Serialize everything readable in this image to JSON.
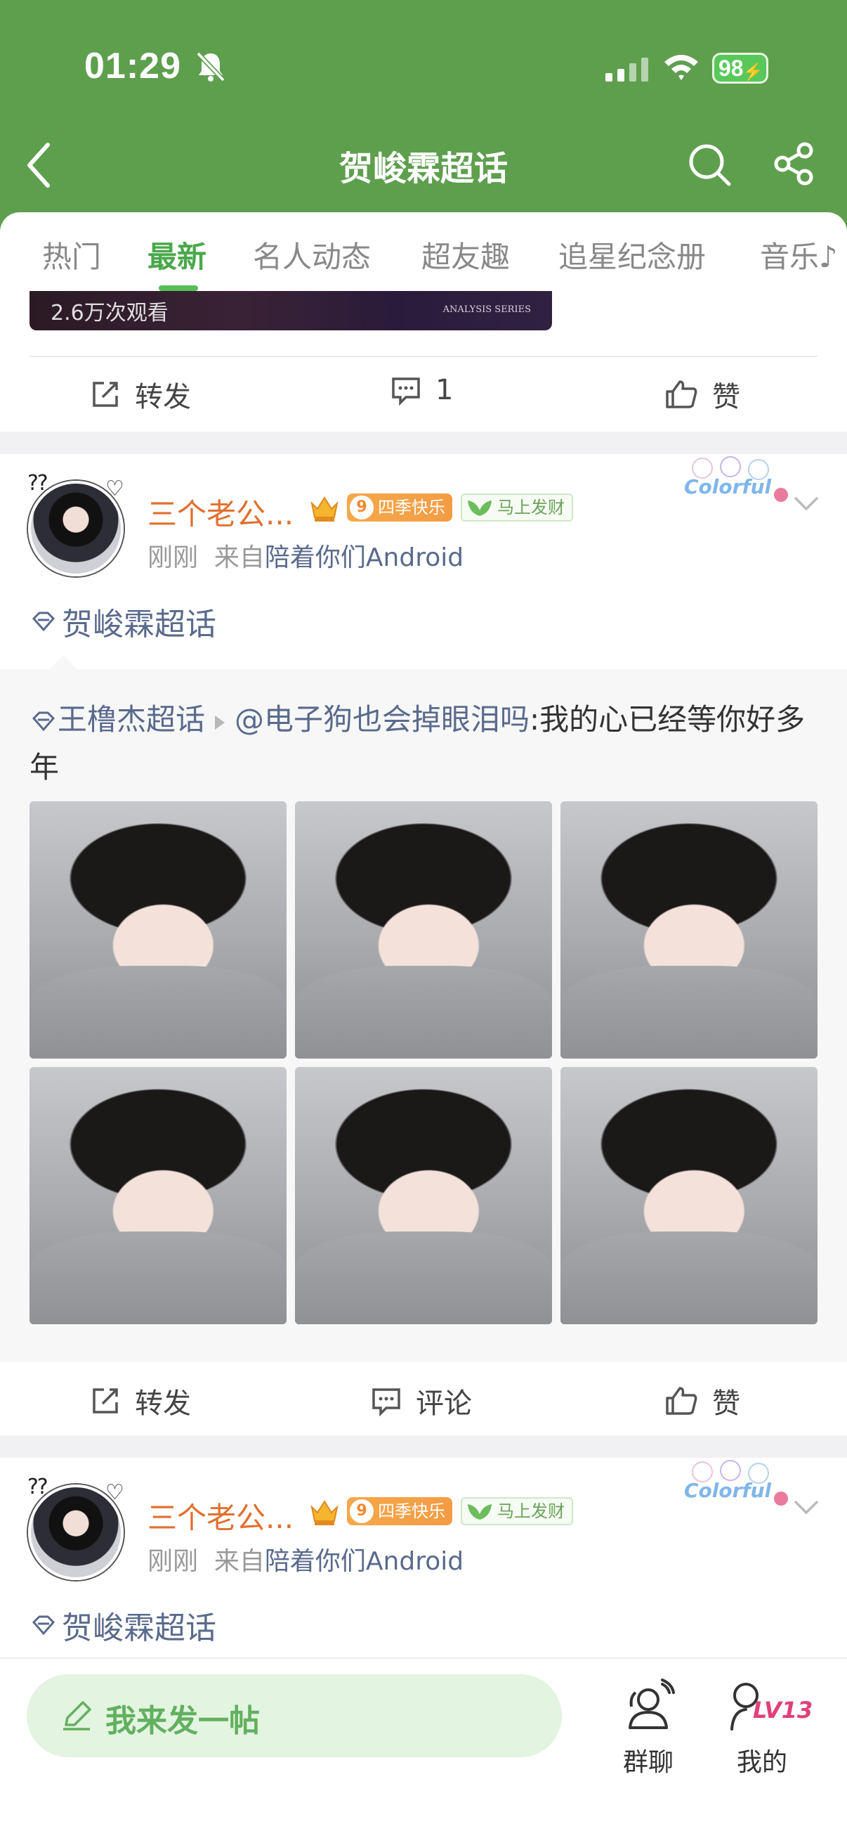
{
  "status_bar": {
    "time": "01:29",
    "battery": "98"
  },
  "header": {
    "title": "贺峻霖超话"
  },
  "tabs": [
    "热门",
    "最新",
    "名人动态",
    "超友趣",
    "追星纪念册",
    "音乐♪"
  ],
  "first_card": {
    "video_views": "2.6万次观看",
    "video_tag": "ANALYSIS SERIES",
    "actions": {
      "repost": "转发",
      "comment": "1",
      "like": "赞"
    }
  },
  "post1": {
    "username": "三个老公...",
    "season_badge_num": "9",
    "season_badge": "四季快乐",
    "rich_badge": "马上发财",
    "time": "刚刚",
    "source_prefix": "来自",
    "source": "陪着你们Android",
    "sticker": "Colorful",
    "topic": "贺峻霖超话",
    "repost": {
      "topic": "王橹杰超话",
      "author": "@电子狗也会掉眼泪吗",
      "text": ":我的心已经等你好多年"
    },
    "actions": {
      "repost": "转发",
      "comment": "评论",
      "like": "赞"
    }
  },
  "post2": {
    "username": "三个老公...",
    "season_badge_num": "9",
    "season_badge": "四季快乐",
    "rich_badge": "马上发财",
    "time": "刚刚",
    "source_prefix": "来自",
    "source": "陪着你们Android",
    "sticker": "Colorful",
    "topic": "贺峻霖超话"
  },
  "bottom_bar": {
    "compose": "我来发一帖",
    "group_chat": "群聊",
    "mine": "我的",
    "level": "LV13"
  },
  "colors": {
    "header_green": "#5e9f4e",
    "active_tab": "#4aa84a",
    "username": "#e07030",
    "link": "#5a6a8c"
  }
}
